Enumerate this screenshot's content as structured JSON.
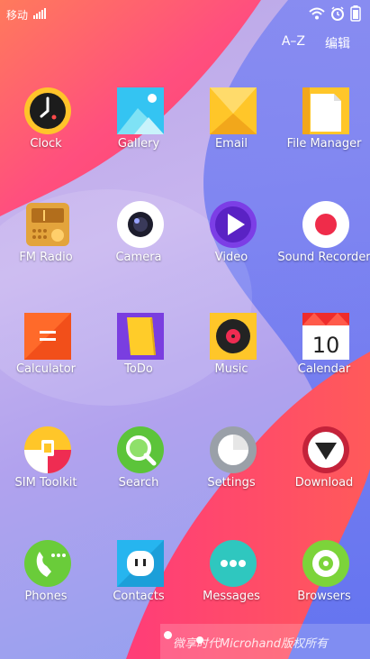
{
  "status": {
    "carrier": "移动"
  },
  "header": {
    "sort_label": "A–Z",
    "edit_label": "编辑"
  },
  "apps": [
    {
      "label": "Clock",
      "icon": "clock-icon"
    },
    {
      "label": "Gallery",
      "icon": "gallery-icon"
    },
    {
      "label": "Email",
      "icon": "email-icon"
    },
    {
      "label": "File Manager",
      "icon": "file-manager-icon"
    },
    {
      "label": "FM Radio",
      "icon": "fm-radio-icon"
    },
    {
      "label": "Camera",
      "icon": "camera-icon"
    },
    {
      "label": "Video",
      "icon": "video-icon"
    },
    {
      "label": "Sound Recorder",
      "icon": "sound-recorder-icon"
    },
    {
      "label": "Calculator",
      "icon": "calculator-icon"
    },
    {
      "label": "ToDo",
      "icon": "todo-icon"
    },
    {
      "label": "Music",
      "icon": "music-icon"
    },
    {
      "label": "Calendar",
      "icon": "calendar-icon",
      "day": "10"
    },
    {
      "label": "SIM Toolkit",
      "icon": "sim-toolkit-icon"
    },
    {
      "label": "Search",
      "icon": "search-icon"
    },
    {
      "label": "Settings",
      "icon": "settings-icon"
    },
    {
      "label": "Download",
      "icon": "download-icon"
    },
    {
      "label": "Phones",
      "icon": "phone-icon"
    },
    {
      "label": "Contacts",
      "icon": "contacts-icon"
    },
    {
      "label": "Messages",
      "icon": "messages-icon"
    },
    {
      "label": "Browsers",
      "icon": "browser-icon"
    }
  ],
  "watermark": {
    "text": "微享时代Microhand版权所有"
  }
}
